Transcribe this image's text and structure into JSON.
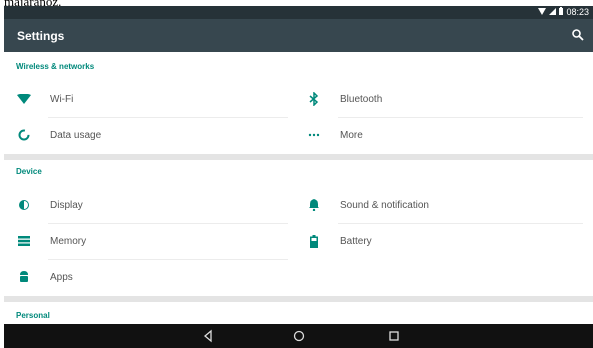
{
  "caption": "majaránoz.",
  "status": {
    "time": "08:23"
  },
  "appbar": {
    "title": "Settings"
  },
  "sections": {
    "wireless": {
      "header": "Wireless & networks",
      "wifi": "Wi-Fi",
      "bluetooth": "Bluetooth",
      "data_usage": "Data usage",
      "more": "More"
    },
    "device": {
      "header": "Device",
      "display": "Display",
      "sound": "Sound & notification",
      "memory": "Memory",
      "battery": "Battery",
      "apps": "Apps"
    },
    "personal": {
      "header": "Personal"
    }
  },
  "colors": {
    "accent": "#00897b",
    "appbar": "#37474f",
    "statusbar": "#263238"
  }
}
